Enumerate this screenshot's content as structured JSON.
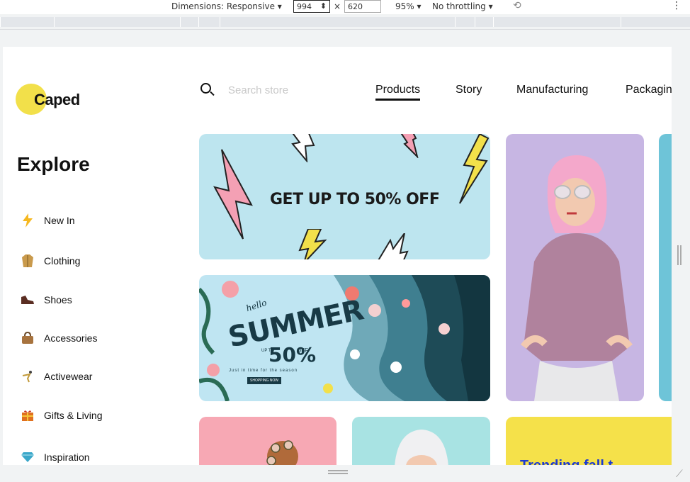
{
  "devtools": {
    "dimensions_label": "Dimensions: Responsive",
    "width_value": "994",
    "times": "×",
    "height_value": "620",
    "zoom": "95%",
    "throttling": "No throttling",
    "dropdown_arrow": "▾",
    "rotate_icon": "⟲",
    "more_icon": "⋮",
    "spinner": "⬍"
  },
  "brand": {
    "name": "Caped"
  },
  "search": {
    "placeholder": "Search store"
  },
  "nav": [
    {
      "label": "Products",
      "active": true
    },
    {
      "label": "Story"
    },
    {
      "label": "Manufacturing"
    },
    {
      "label": "Packaging"
    }
  ],
  "sidebar": {
    "heading": "Explore",
    "items": [
      {
        "label": "New In",
        "icon": "lightning-icon"
      },
      {
        "label": "Clothing",
        "icon": "coat-icon"
      },
      {
        "label": "Shoes",
        "icon": "shoe-icon"
      },
      {
        "label": "Accessories",
        "icon": "bag-icon"
      },
      {
        "label": "Activewear",
        "icon": "activewear-icon"
      },
      {
        "label": "Gifts & Living",
        "icon": "gift-icon"
      },
      {
        "label": "Inspiration",
        "icon": "diamond-icon"
      }
    ]
  },
  "banners": {
    "sale": "GET UP TO 50% OFF",
    "summer": {
      "hello": "hello",
      "title": "SUMMER",
      "upto": "UP TO",
      "percent": "50%",
      "off": "OFF",
      "subtitle": "Just in time for the season",
      "button": "SHOPPING NOW"
    },
    "trending": "Trending fall t..."
  },
  "colors": {
    "accent_yellow": "#f2e04a",
    "sale_bg": "#bde5ef",
    "summer_dark": "#183a46",
    "model_bg": "#c7b6e3",
    "pink_card": "#f7a8b4",
    "teal_card": "#a8e3e3",
    "trend_blue": "#1d3ad1"
  }
}
